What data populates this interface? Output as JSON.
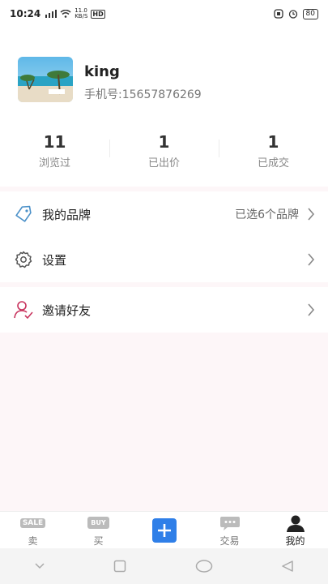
{
  "status_bar": {
    "time": "10:24",
    "network_speed": "11.0\nKB/S",
    "battery": "80"
  },
  "profile": {
    "username": "king",
    "phone": "手机号:15657876269"
  },
  "stats": [
    {
      "value": "11",
      "label": "浏览过"
    },
    {
      "value": "1",
      "label": "已出价"
    },
    {
      "value": "1",
      "label": "已成交"
    }
  ],
  "menu": {
    "brands": {
      "label": "我的品牌",
      "value": "已选6个品牌"
    },
    "settings": {
      "label": "设置"
    },
    "invite": {
      "label": "邀请好友"
    }
  },
  "tabbar": [
    {
      "label": "卖",
      "icon": "sale-icon",
      "badge": "SALE"
    },
    {
      "label": "买",
      "icon": "buy-icon",
      "badge": "BUY"
    },
    {
      "label": "",
      "icon": "plus-icon"
    },
    {
      "label": "交易",
      "icon": "chat-icon"
    },
    {
      "label": "我的",
      "icon": "person-icon"
    }
  ],
  "colors": {
    "accent": "#2f7fe8",
    "brand_icon": "#4a90c8",
    "invite_icon": "#c8345e"
  }
}
